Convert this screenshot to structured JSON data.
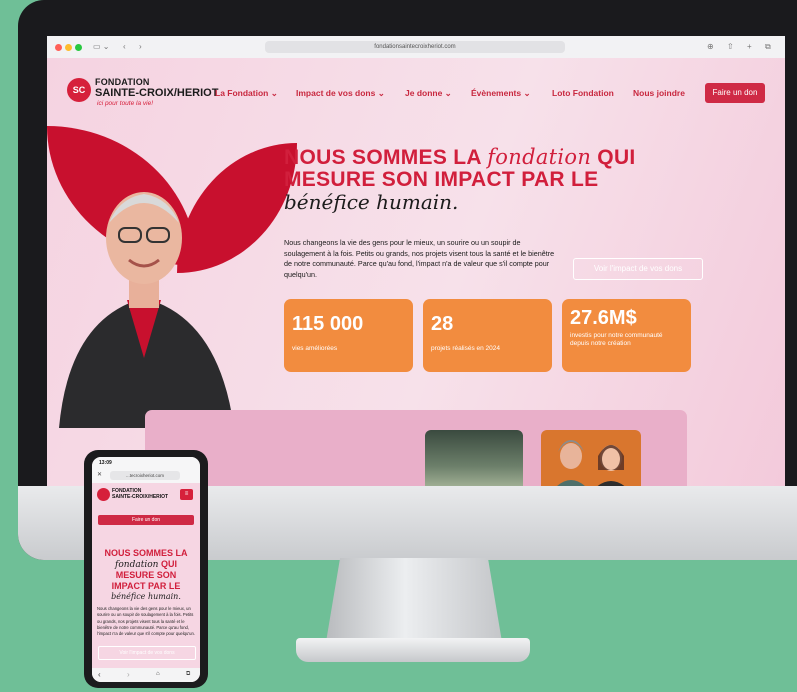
{
  "browser": {
    "url": "fondationsaintecroixheriot.com"
  },
  "site": {
    "logo": {
      "line1": "FONDATION",
      "line2": "SAINTE-CROIX/HERIOT",
      "tagline": "ici pour toute la vie!"
    },
    "nav": [
      "La Fondation ⌄",
      "Impact de vos dons ⌄",
      "Je donne ⌄",
      "Évènements ⌄",
      "Loto Fondation",
      "Nous joindre"
    ],
    "donate": "Faire un don",
    "hero": {
      "line1a": "NOUS SOMMES LA ",
      "line1b": "fondation",
      "line1c": " QUI",
      "line2": "MESURE SON IMPACT PAR LE",
      "line3": "bénéfice humain.",
      "paragraph": "Nous changeons la vie des gens pour le mieux, un sourire ou un soupir de soulagement à la fois. Petits ou grands, nos projets visent tous la santé et le bienêtre de notre communauté. Parce qu'au fond, l'impact n'a de valeur que s'il compte pour quelqu'un.",
      "cta": "Voir l'impact de vos dons"
    },
    "stats": [
      {
        "value": "115 000",
        "label": "vies améliorées"
      },
      {
        "value": "28",
        "label": "projets réalisés en 2024"
      },
      {
        "value": "27.6M$",
        "label": "investis pour notre communauté depuis notre création"
      }
    ]
  },
  "phone": {
    "time": "13:09",
    "url": "...tecroixheriot.com",
    "donate": "Faire un don",
    "h1": "NOUS SOMMES LA",
    "h2a": "fondation",
    "h2b": " QUI",
    "h3": "MESURE SON",
    "h4": "IMPACT PAR LE",
    "h5": "bénéfice humain.",
    "paragraph": "Nous changeons la vie des gens pour le mieux, un sourire ou un soupir de soulagement à la fois. Petits ou grands, nos projets visent tous la santé et le bienêtre de notre communauté. Parce qu'au fond, l'impact n'a de valeur que s'il compte pour quelqu'un.",
    "cta": "Voir l'impact de vos dons"
  },
  "colors": {
    "brand_red": "#d11f3c",
    "orange": "#f28c3f",
    "background": "#6fbf97"
  }
}
